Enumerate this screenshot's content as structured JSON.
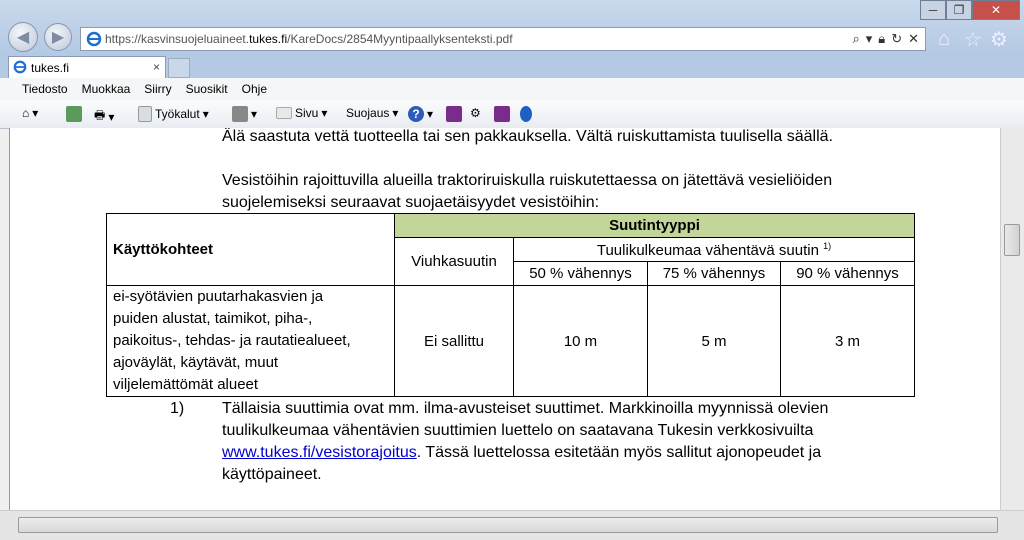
{
  "browser": {
    "url_prefix": "https://kasvinsuojeluaineet.",
    "url_domain": "tukes.fi",
    "url_path": "/KareDocs/2854Myyntipaallyksenteksti.pdf",
    "tab_title": "tukes.fi",
    "tab_close": "×",
    "menu": [
      "Tiedosto",
      "Muokkaa",
      "Siirry",
      "Suosikit",
      "Ohje"
    ],
    "commands": {
      "tools": "Työkalut",
      "page": "Sivu",
      "safety": "Suojaus"
    }
  },
  "doc": {
    "line1": "Älä saastuta vettä tuotteella tai sen pakkauksella. Vältä ruiskuttamista tuulisella säällä.",
    "line2": "Vesistöihin rajoittuvilla alueilla traktoriruiskulla ruiskutettaessa on jätettävä vesieliöiden",
    "line3": "suojelemiseksi seuraavat suojaetäisyydet vesistöihin:",
    "table": {
      "header_group": "Suutintyyppi",
      "col_usage": "Käyttökohteet",
      "col_fan": "Viuhkasuutin",
      "col_drift": "Tuulikulkeumaa vähentävä suutin",
      "col_drift_note": "1)",
      "sub": [
        "50 % vähennys",
        "75 % vähennys",
        "90 % vähennys"
      ],
      "row_usage": [
        "ei-syötävien puutarhakasvien ja",
        "puiden alustat, taimikot, piha-,",
        "paikoitus-, tehdas- ja rautatiealueet,",
        "ajoväylät, käytävät, muut",
        "viljelemättömät alueet"
      ],
      "row_fan": "Ei sallittu",
      "row_values": [
        "10 m",
        "5 m",
        "3 m"
      ]
    },
    "footnote_num": "1)",
    "fn1": "Tällaisia suuttimia ovat mm. ilma-avusteiset suuttimet. Markkinoilla myynnissä olevien",
    "fn2": "tuulikulkeumaa vähentävien suuttimien luettelo on saatavana Tukesin verkkosivuilta",
    "fn3_link": "www.tukes.fi/vesistorajoitus",
    "fn3_rest": ". Tässä luettelossa esitetään myös sallitut ajonopeudet ja",
    "fn4": "käyttöpaineet."
  }
}
